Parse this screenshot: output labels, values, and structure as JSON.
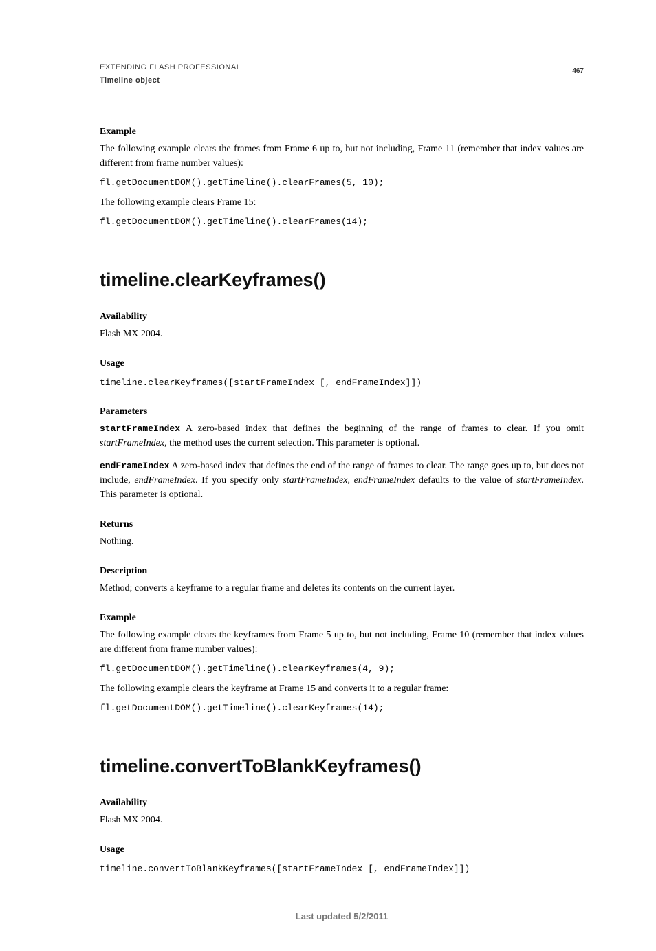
{
  "header": {
    "title": "EXTENDING FLASH PROFESSIONAL",
    "subtitle": "Timeline object",
    "page_number": "467"
  },
  "top_section": {
    "example_hdr": "Example",
    "example_intro": "The following example clears the frames from Frame 6 up to, but not including, Frame 11 (remember that index values are different from frame number values):",
    "code1": "fl.getDocumentDOM().getTimeline().clearFrames(5, 10);",
    "example_mid": "The following example clears Frame 15:",
    "code2": "fl.getDocumentDOM().getTimeline().clearFrames(14);"
  },
  "section1": {
    "title": "timeline.clearKeyframes()",
    "availability_hdr": "Availability",
    "availability_val": "Flash MX 2004.",
    "usage_hdr": "Usage",
    "usage_code": "timeline.clearKeyframes([startFrameIndex [, endFrameIndex]])",
    "parameters_hdr": "Parameters",
    "param1_name": "startFrameIndex",
    "param1_desc_a": "  A zero-based index that defines the beginning of the range of frames to clear. If you omit ",
    "param1_desc_b": "startFrameIndex",
    "param1_desc_c": ", the method uses the current selection. This parameter is optional.",
    "param2_name": "endFrameIndex",
    "param2_desc_a": "  A zero-based index that defines the end of the range of frames to clear. The range goes up to, but does not include, ",
    "param2_desc_b": "endFrameIndex",
    "param2_desc_c": ". If you specify only ",
    "param2_desc_d": "startFrameIndex",
    "param2_desc_e": ", ",
    "param2_desc_f": "endFrameIndex",
    "param2_desc_g": " defaults to the value of ",
    "param2_desc_h": "startFrameIndex",
    "param2_desc_i": ". This parameter is optional.",
    "returns_hdr": "Returns",
    "returns_val": "Nothing.",
    "description_hdr": "Description",
    "description_val": "Method; converts a keyframe to a regular frame and deletes its contents on the current layer.",
    "example_hdr": "Example",
    "example_intro": "The following example clears the keyframes from Frame 5 up to, but not including, Frame 10 (remember that index values are different from frame number values):",
    "code1": "fl.getDocumentDOM().getTimeline().clearKeyframes(4, 9);",
    "example_mid": "The following example clears the keyframe at Frame 15 and converts it to a regular frame:",
    "code2": "fl.getDocumentDOM().getTimeline().clearKeyframes(14);"
  },
  "section2": {
    "title": "timeline.convertToBlankKeyframes()",
    "availability_hdr": "Availability",
    "availability_val": "Flash MX 2004.",
    "usage_hdr": "Usage",
    "usage_code": "timeline.convertToBlankKeyframes([startFrameIndex [, endFrameIndex]])"
  },
  "footer": "Last updated 5/2/2011"
}
